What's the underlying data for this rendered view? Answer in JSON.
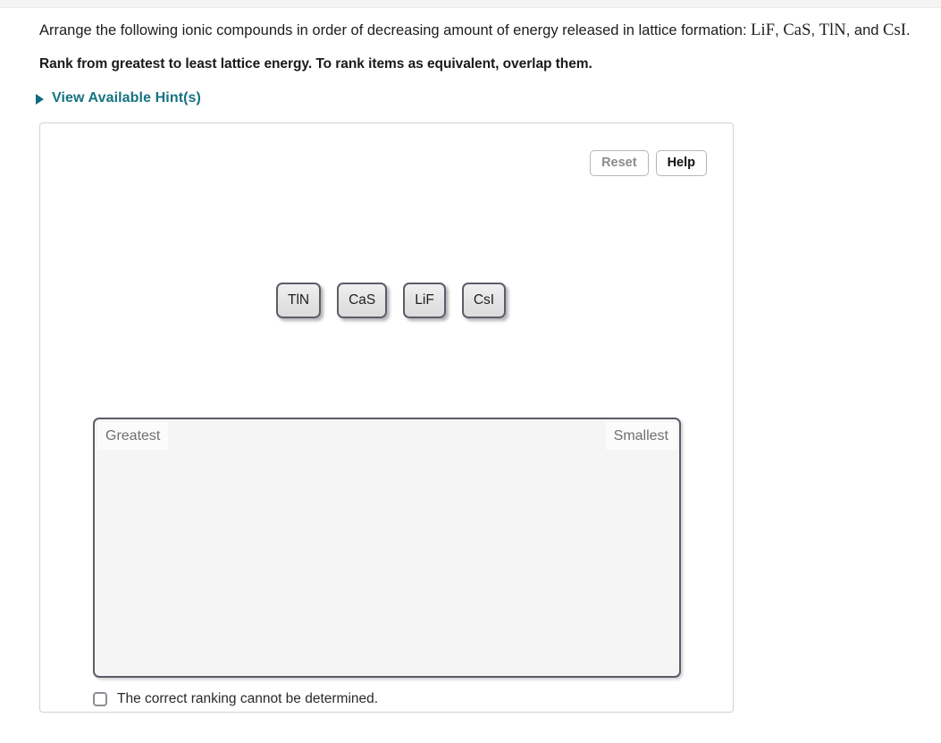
{
  "question": {
    "text_before": "Arrange the following ionic compounds in order of decreasing amount of energy released in lattice formation: ",
    "compound_1": "LiF",
    "sep_1": ", ",
    "compound_2": "CaS",
    "sep_2": ", ",
    "compound_3": "TlN",
    "sep_3": ", and ",
    "compound_4": "CsI",
    "sep_4": "."
  },
  "instruction": "Rank from greatest to least lattice energy. To rank items as equivalent, overlap them.",
  "hints": {
    "label": "View Available Hint(s)",
    "caret_icon": "triangle-right-icon",
    "color": "#157382"
  },
  "toolbar": {
    "reset_label": "Reset",
    "help_label": "Help",
    "reset_color": "#8c8c8c",
    "help_color": "#111111"
  },
  "tiles": [
    {
      "label": "TlN"
    },
    {
      "label": "CaS"
    },
    {
      "label": "LiF"
    },
    {
      "label": "CsI"
    }
  ],
  "drop_zone": {
    "left_label": "Greatest",
    "right_label": "Smallest",
    "fill_color": "#f5f5f5",
    "border_color": "#5d5d68"
  },
  "cannot_determine": {
    "label": "The correct ranking cannot be determined.",
    "checked": false,
    "checkbox_icon": "checkbox-unchecked-icon"
  }
}
